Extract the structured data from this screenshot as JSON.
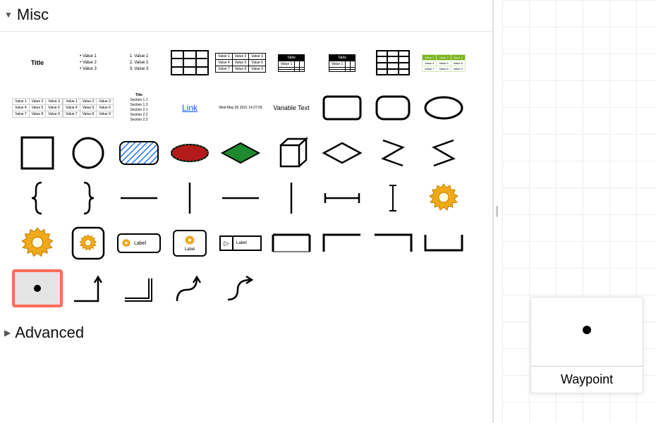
{
  "sections": {
    "misc": {
      "title": "Misc",
      "expanded": true
    },
    "advanced": {
      "title": "Advanced",
      "expanded": false
    }
  },
  "tooltip": {
    "label": "Waypoint"
  },
  "shapes": {
    "title_text": "Title",
    "bullet_items": [
      "Value 1",
      "Value 2",
      "Value 3"
    ],
    "numbered_items": [
      "1. Value 1",
      "2. Value 2",
      "3. Value 3"
    ],
    "table4x3_header": "Table",
    "mini_table_cells": [
      "Value 1",
      "Value 2",
      "Value 3",
      "Value 4",
      "Value 5",
      "Value 6",
      "Value 7",
      "Value 8",
      "Value 9"
    ],
    "link_text": "Link",
    "timestamp_text": "Wed May 05 2021 14:27:09",
    "variable_text": "Variable Text",
    "doc_title": "Title",
    "doc_sections": [
      "Section 1.1",
      "Section 1.2",
      "Section 2.1",
      "Section 2.2",
      "Section 2.3"
    ],
    "label_text": "Label",
    "label_sm_text": "Label"
  }
}
